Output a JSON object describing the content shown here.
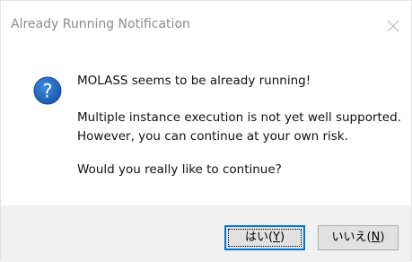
{
  "window": {
    "title": "Already Running Notification"
  },
  "icons": {
    "close": "close-icon",
    "info": "question-icon",
    "info_glyph": "?",
    "info_color": "#1e63b8"
  },
  "message": {
    "line1": "MOLASS seems to be already running!",
    "line2": "Multiple instance execution is not yet well supported.",
    "line3": "However, you can continue at your own risk.",
    "line4": "Would you really like to continue?"
  },
  "buttons": {
    "yes_text": "はい(",
    "yes_mnemonic": "Y",
    "yes_close": ")",
    "no_text": "いいえ(",
    "no_mnemonic": "N",
    "no_close": ")"
  },
  "colors": {
    "focus_border": "#0078d7",
    "footer_bg": "#f0f0f0",
    "title_text": "#8c8c8c"
  }
}
